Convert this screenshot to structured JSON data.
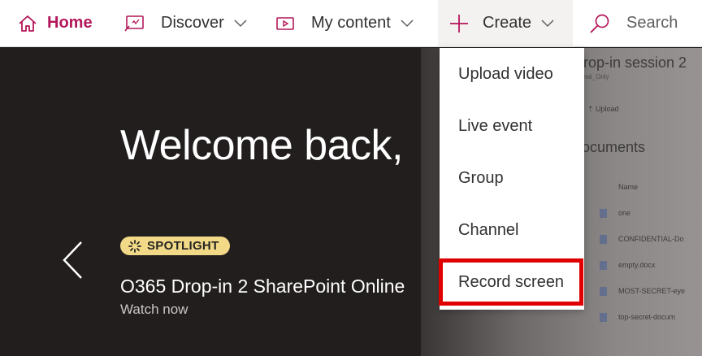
{
  "nav": {
    "home": "Home",
    "discover": "Discover",
    "my_content": "My content",
    "create": "Create",
    "search": "Search"
  },
  "create_menu": {
    "items": [
      "Upload video",
      "Live event",
      "Group",
      "Channel",
      "Record screen"
    ],
    "highlighted": "Record screen"
  },
  "hero": {
    "welcome": "Welcome back,",
    "badge": "SPOTLIGHT",
    "feature_title": "O365 Drop-in 2 SharePoint Online",
    "watch_now": "Watch now"
  },
  "background_preview": {
    "title": "rop-in session 2",
    "subtitle": "nal_Only",
    "toolbar": "Upload",
    "section": "ocuments",
    "column_name": "Name",
    "files": [
      "one",
      "CONFIDENTIAL-Do",
      "empty.docx",
      "MOST-SECRET-eye",
      "top-secret-docum"
    ]
  },
  "colors": {
    "brand": "#b4165a",
    "badge": "#f2d987",
    "highlight": "#e00000"
  }
}
